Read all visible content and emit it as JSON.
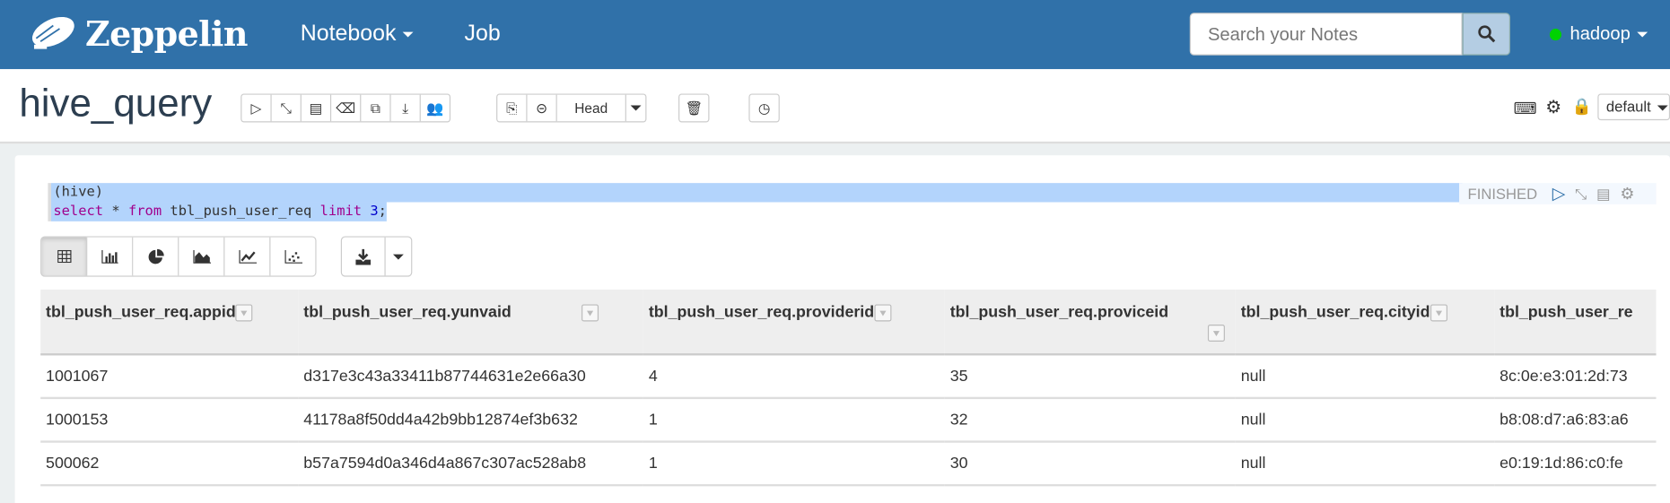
{
  "navbar": {
    "brand": "Zeppelin",
    "notebook_label": "Notebook",
    "job_label": "Job",
    "search_placeholder": "Search your Notes",
    "user": "hadoop",
    "status_color": "#00d200",
    "brand_color": "#3071a9"
  },
  "notebook": {
    "title": "hive_query",
    "version_label": "Head",
    "interpreter_binding": "default"
  },
  "paragraph": {
    "code_line1": "(hive)",
    "code_line2": {
      "kw1": "select",
      "mid1": " * ",
      "kw2": "from",
      "mid2": " tbl_push_user_req ",
      "kw3": "limit",
      "sp": " ",
      "num": "3",
      "end": ";"
    },
    "status": "FINISHED"
  },
  "table": {
    "columns": [
      "tbl_push_user_req.appid",
      "tbl_push_user_req.yunvaid",
      "tbl_push_user_req.providerid",
      "tbl_push_user_req.proviceid",
      "tbl_push_user_req.cityid",
      "tbl_push_user_re"
    ],
    "rows": [
      [
        "1001067",
        "d317e3c43a33411b87744631e2e66a30",
        "4",
        "35",
        "null",
        "8c:0e:e3:01:2d:73"
      ],
      [
        "1000153",
        "41178a8f50dd4a42b9bb12874ef3b632",
        "1",
        "32",
        "null",
        "b8:08:d7:a6:83:a6"
      ],
      [
        "500062",
        "b57a7594d0a346d4a867c307ac528ab8",
        "1",
        "30",
        "null",
        "e0:19:1d:86:c0:fe"
      ]
    ]
  }
}
